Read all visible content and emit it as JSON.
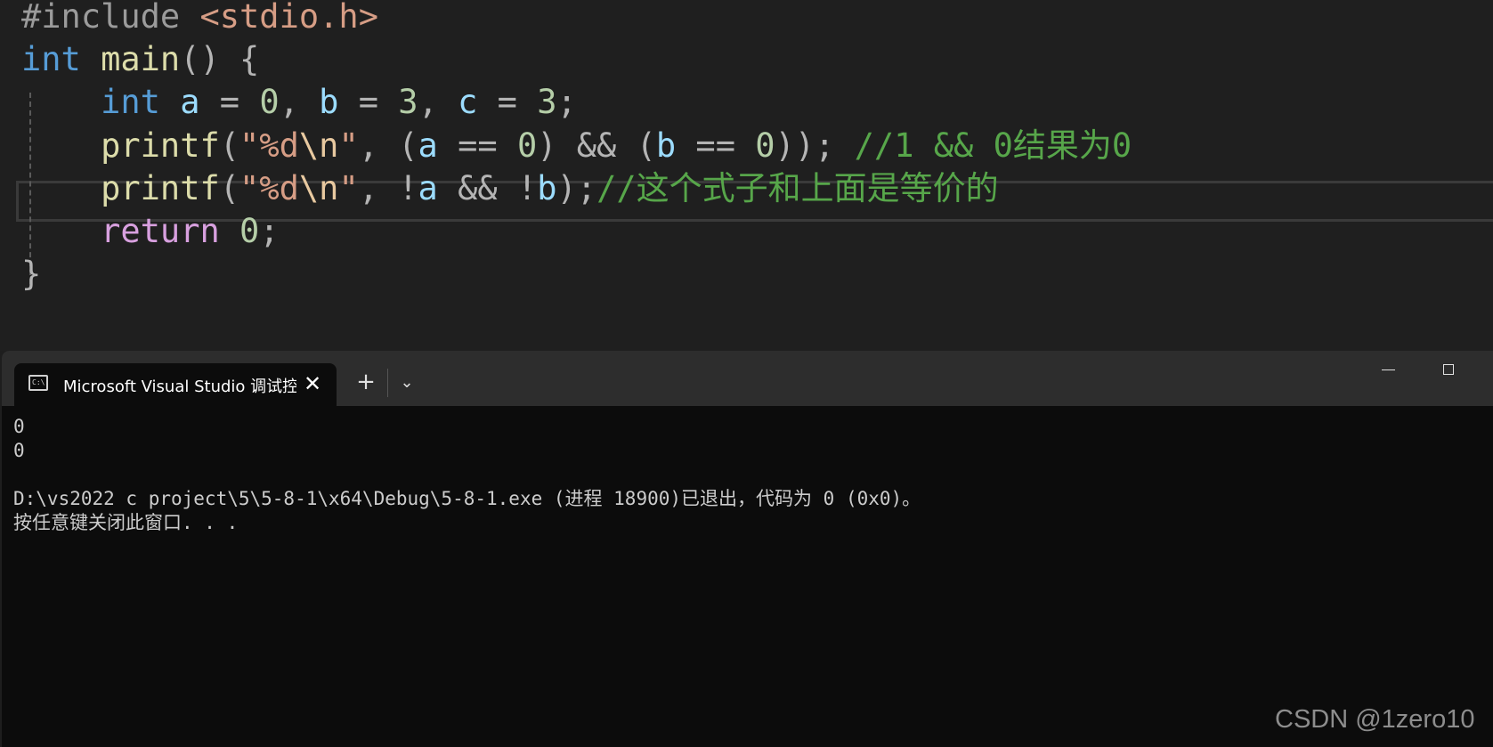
{
  "editor": {
    "lines": [
      [
        {
          "t": "#include ",
          "c": "pre"
        },
        {
          "t": "<stdio.h>",
          "c": "inc"
        }
      ],
      [
        {
          "t": "int",
          "c": "kw"
        },
        {
          "t": " ",
          "c": ""
        },
        {
          "t": "main",
          "c": "fn"
        },
        {
          "t": "() {",
          "c": "pun"
        }
      ],
      [
        {
          "t": "    ",
          "c": ""
        },
        {
          "t": "int",
          "c": "kw"
        },
        {
          "t": " ",
          "c": ""
        },
        {
          "t": "a",
          "c": "var"
        },
        {
          "t": " = ",
          "c": "pun"
        },
        {
          "t": "0",
          "c": "num"
        },
        {
          "t": ", ",
          "c": "pun"
        },
        {
          "t": "b",
          "c": "var"
        },
        {
          "t": " = ",
          "c": "pun"
        },
        {
          "t": "3",
          "c": "num"
        },
        {
          "t": ", ",
          "c": "pun"
        },
        {
          "t": "c",
          "c": "var"
        },
        {
          "t": " = ",
          "c": "pun"
        },
        {
          "t": "3",
          "c": "num"
        },
        {
          "t": ";",
          "c": "pun"
        }
      ],
      [
        {
          "t": "    ",
          "c": ""
        },
        {
          "t": "printf",
          "c": "fn"
        },
        {
          "t": "(",
          "c": "pun"
        },
        {
          "t": "\"%d",
          "c": "str"
        },
        {
          "t": "\\n",
          "c": "esc"
        },
        {
          "t": "\"",
          "c": "str"
        },
        {
          "t": ", (",
          "c": "pun"
        },
        {
          "t": "a",
          "c": "var"
        },
        {
          "t": " == ",
          "c": "pun"
        },
        {
          "t": "0",
          "c": "num"
        },
        {
          "t": ") && (",
          "c": "pun"
        },
        {
          "t": "b",
          "c": "var"
        },
        {
          "t": " == ",
          "c": "pun"
        },
        {
          "t": "0",
          "c": "num"
        },
        {
          "t": ")); ",
          "c": "pun"
        },
        {
          "t": "//1 && 0结果为0",
          "c": "cmt"
        }
      ],
      [
        {
          "t": "    ",
          "c": ""
        },
        {
          "t": "printf",
          "c": "fn"
        },
        {
          "t": "(",
          "c": "pun"
        },
        {
          "t": "\"%d",
          "c": "str"
        },
        {
          "t": "\\n",
          "c": "esc"
        },
        {
          "t": "\"",
          "c": "str"
        },
        {
          "t": ", !",
          "c": "pun"
        },
        {
          "t": "a",
          "c": "var"
        },
        {
          "t": " && !",
          "c": "pun"
        },
        {
          "t": "b",
          "c": "var"
        },
        {
          "t": ");",
          "c": "pun"
        },
        {
          "t": "//这个式子和上面是等价的",
          "c": "cmt"
        }
      ],
      [
        {
          "t": "    ",
          "c": ""
        },
        {
          "t": "return",
          "c": "ctl"
        },
        {
          "t": " ",
          "c": ""
        },
        {
          "t": "0",
          "c": "num"
        },
        {
          "t": ";",
          "c": "pun"
        }
      ],
      [
        {
          "t": "}",
          "c": "pun"
        }
      ]
    ]
  },
  "console": {
    "tab_title": "Microsoft Visual Studio 调试控",
    "tab_icon_text": "C:\\",
    "close_glyph": "✕",
    "new_tab_glyph": "+",
    "dropdown_glyph": "⌄",
    "output": "0\n0\n\nD:\\vs2022 c project\\5\\5-8-1\\x64\\Debug\\5-8-1.exe (进程 18900)已退出，代码为 0 (0x0)。\n按任意键关闭此窗口. . ."
  },
  "watermark": "CSDN @1zero10"
}
